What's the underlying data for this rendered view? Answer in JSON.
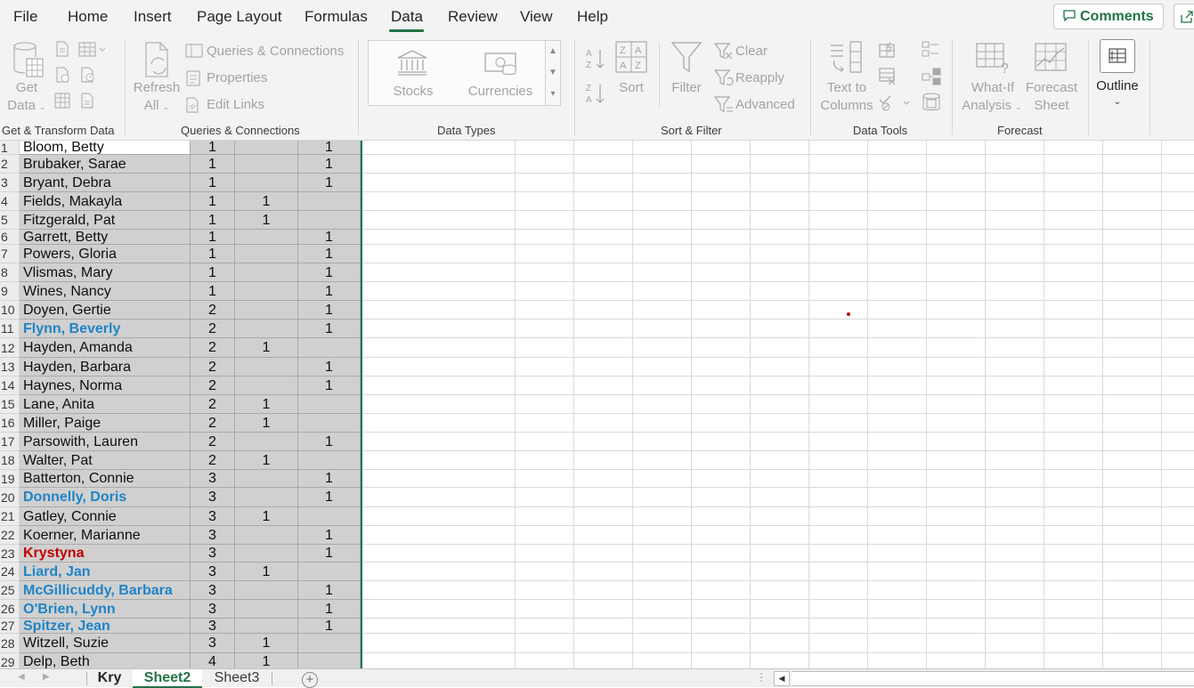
{
  "menu": {
    "tabs": [
      "File",
      "Home",
      "Insert",
      "Page Layout",
      "Formulas",
      "Data",
      "Review",
      "View",
      "Help"
    ],
    "active_tab": "Data",
    "comments_label": "Comments"
  },
  "ribbon": {
    "get_transform": {
      "get_data_line1": "Get",
      "get_data_line2": "Data",
      "group_label": "Get & Transform Data"
    },
    "queries": {
      "refresh_line1": "Refresh",
      "refresh_line2": "All",
      "queries_connections": "Queries & Connections",
      "properties": "Properties",
      "edit_links": "Edit Links",
      "group_label": "Queries & Connections"
    },
    "data_types": {
      "stocks": "Stocks",
      "currencies": "Currencies",
      "group_label": "Data Types"
    },
    "sort_filter": {
      "sort": "Sort",
      "filter": "Filter",
      "clear": "Clear",
      "reapply": "Reapply",
      "advanced": "Advanced",
      "group_label": "Sort & Filter"
    },
    "data_tools": {
      "text_to_columns_line1": "Text to",
      "text_to_columns_line2": "Columns",
      "group_label": "Data Tools"
    },
    "forecast": {
      "what_if_line1": "What-If",
      "what_if_line2": "Analysis",
      "forecast_sheet_line1": "Forecast",
      "forecast_sheet_line2": "Sheet",
      "group_label": "Forecast"
    },
    "outline": {
      "label": "Outline"
    }
  },
  "sheet": {
    "rows": [
      {
        "n": "1",
        "name": "Bloom, Betty",
        "b": "1",
        "c": "",
        "d": "1",
        "style": "first"
      },
      {
        "n": "2",
        "name": "Brubaker, Sarae",
        "b": "1",
        "c": "",
        "d": "1",
        "style": ""
      },
      {
        "n": "3",
        "name": "Bryant, Debra",
        "b": "1",
        "c": "",
        "d": "1",
        "style": ""
      },
      {
        "n": "4",
        "name": "Fields, Makayla",
        "b": "1",
        "c": "1",
        "d": "",
        "style": ""
      },
      {
        "n": "5",
        "name": "Fitzgerald, Pat",
        "b": "1",
        "c": "1",
        "d": "",
        "style": ""
      },
      {
        "n": "6",
        "name": "Garrett, Betty",
        "b": "1",
        "c": "",
        "d": "1",
        "style": ""
      },
      {
        "n": "7",
        "name": "Powers, Gloria",
        "b": "1",
        "c": "",
        "d": "1",
        "style": ""
      },
      {
        "n": "8",
        "name": "Vlismas, Mary",
        "b": "1",
        "c": "",
        "d": "1",
        "style": ""
      },
      {
        "n": "9",
        "name": "Wines, Nancy",
        "b": "1",
        "c": "",
        "d": "1",
        "style": ""
      },
      {
        "n": "10",
        "name": "Doyen, Gertie",
        "b": "2",
        "c": "",
        "d": "1",
        "style": ""
      },
      {
        "n": "11",
        "name": "Flynn, Beverly",
        "b": "2",
        "c": "",
        "d": "1",
        "style": "blue"
      },
      {
        "n": "12",
        "name": "Hayden, Amanda",
        "b": "2",
        "c": "1",
        "d": "",
        "style": ""
      },
      {
        "n": "13",
        "name": "Hayden, Barbara",
        "b": "2",
        "c": "",
        "d": "1",
        "style": ""
      },
      {
        "n": "14",
        "name": "Haynes, Norma",
        "b": "2",
        "c": "",
        "d": "1",
        "style": ""
      },
      {
        "n": "15",
        "name": "Lane, Anita",
        "b": "2",
        "c": "1",
        "d": "",
        "style": ""
      },
      {
        "n": "16",
        "name": "Miller, Paige",
        "b": "2",
        "c": "1",
        "d": "",
        "style": ""
      },
      {
        "n": "17",
        "name": "Parsowith, Lauren",
        "b": "2",
        "c": "",
        "d": "1",
        "style": ""
      },
      {
        "n": "18",
        "name": "Walter, Pat",
        "b": "2",
        "c": "1",
        "d": "",
        "style": ""
      },
      {
        "n": "19",
        "name": "Batterton, Connie",
        "b": "3",
        "c": "",
        "d": "1",
        "style": ""
      },
      {
        "n": "20",
        "name": "Donnelly, Doris",
        "b": "3",
        "c": "",
        "d": "1",
        "style": "blue"
      },
      {
        "n": "21",
        "name": "Gatley, Connie",
        "b": "3",
        "c": "1",
        "d": "",
        "style": ""
      },
      {
        "n": "22",
        "name": "Koerner, Marianne",
        "b": "3",
        "c": "",
        "d": "1",
        "style": ""
      },
      {
        "n": "23",
        "name": "Krystyna",
        "b": "3",
        "c": "",
        "d": "1",
        "style": "red"
      },
      {
        "n": "24",
        "name": "Liard, Jan",
        "b": "3",
        "c": "1",
        "d": "",
        "style": "blue"
      },
      {
        "n": "25",
        "name": "McGillicuddy, Barbara",
        "b": "3",
        "c": "",
        "d": "1",
        "style": "blue"
      },
      {
        "n": "26",
        "name": "O'Brien, Lynn",
        "b": "3",
        "c": "",
        "d": "1",
        "style": "blue"
      },
      {
        "n": "27",
        "name": "Spitzer, Jean",
        "b": "3",
        "c": "",
        "d": "1",
        "style": "blue"
      },
      {
        "n": "28",
        "name": "Witzell, Suzie",
        "b": "3",
        "c": "1",
        "d": "",
        "style": ""
      },
      {
        "n": "29",
        "name": "Delp, Beth",
        "b": "4",
        "c": "1",
        "d": "",
        "style": ""
      }
    ]
  },
  "sheet_tabs": {
    "tabs": [
      "Kry",
      "Sheet2",
      "Sheet3"
    ],
    "active": "Sheet2"
  },
  "colors": {
    "accent": "#217346",
    "highlight_blue": "#2084c7",
    "highlight_red": "#c00000",
    "selection_fill": "#d0d0d0"
  }
}
